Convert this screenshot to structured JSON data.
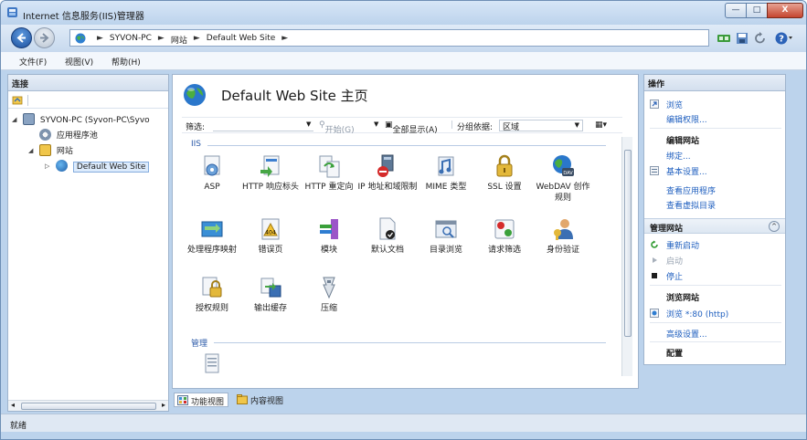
{
  "window": {
    "title": "Internet 信息服务(IIS)管理器",
    "controls": {
      "minimize": "—",
      "maximize": "□",
      "close": "X"
    }
  },
  "address": {
    "crumbs": [
      "SYVON-PC",
      "网站",
      "Default Web Site"
    ],
    "separator": "►"
  },
  "menu": {
    "items": [
      "文件(F)",
      "视图(V)",
      "帮助(H)"
    ]
  },
  "connections": {
    "header": "连接",
    "tree": [
      {
        "label": "SYVON-PC (Syvon-PC\\Syvo",
        "expander": "◢",
        "icon": "server-icon"
      },
      {
        "label": "应用程序池",
        "expander": "",
        "icon": "app-pool-icon"
      },
      {
        "label": "网站",
        "expander": "◢",
        "icon": "sites-folder-icon"
      },
      {
        "label": "Default Web Site",
        "expander": "▷",
        "icon": "website-globe-icon"
      }
    ],
    "scroll_left": "◂",
    "scroll_right": "▸"
  },
  "home": {
    "title": "Default Web Site 主页",
    "filter": {
      "label": "筛选:",
      "go": "开始(G)",
      "show_all": "全部显示(A)",
      "group_by_label": "分组依据:",
      "group_by_value": "区域"
    },
    "sections": [
      {
        "name": "IIS",
        "features": [
          {
            "label": "ASP",
            "icon": "asp-icon"
          },
          {
            "label": "HTTP 响应标头",
            "icon": "http-response-headers-icon"
          },
          {
            "label": "HTTP 重定向",
            "icon": "http-redirect-icon"
          },
          {
            "label": "IP 地址和域限制",
            "icon": "ip-domain-restrictions-icon"
          },
          {
            "label": "MIME 类型",
            "icon": "mime-types-icon"
          },
          {
            "label": "SSL 设置",
            "icon": "ssl-lock-icon"
          },
          {
            "label": "WebDAV 创作规则",
            "icon": "webdav-icon"
          },
          {
            "label": "处理程序映射",
            "icon": "handler-mappings-icon"
          },
          {
            "label": "错误页",
            "icon": "error-pages-icon"
          },
          {
            "label": "模块",
            "icon": "modules-icon"
          },
          {
            "label": "默认文档",
            "icon": "default-document-icon"
          },
          {
            "label": "目录浏览",
            "icon": "directory-browsing-icon"
          },
          {
            "label": "请求筛选",
            "icon": "request-filtering-icon"
          },
          {
            "label": "身份验证",
            "icon": "authentication-icon"
          },
          {
            "label": "授权规则",
            "icon": "authorization-rules-icon"
          },
          {
            "label": "输出缓存",
            "icon": "output-caching-icon"
          },
          {
            "label": "压缩",
            "icon": "compression-icon"
          }
        ]
      },
      {
        "name": "管理",
        "features": [
          {
            "label": "",
            "icon": "configuration-editor-icon"
          }
        ]
      }
    ],
    "view_tabs": [
      {
        "label": "功能视图",
        "active": true
      },
      {
        "label": "内容视图",
        "active": false
      }
    ]
  },
  "actions": {
    "header": "操作",
    "top_links": [
      "浏览",
      "编辑权限..."
    ],
    "edit_site": {
      "title": "编辑网站",
      "links": [
        "绑定...",
        "基本设置...",
        "查看应用程序",
        "查看虚拟目录"
      ]
    },
    "manage_site": {
      "title": "管理网站",
      "collapse": "^",
      "links": [
        {
          "label": "重新启动",
          "disabled": false
        },
        {
          "label": "启动",
          "disabled": true
        },
        {
          "label": "停止",
          "disabled": false
        }
      ]
    },
    "browse_site": {
      "title": "浏览网站",
      "links": [
        "浏览 *:80 (http)",
        "高级设置..."
      ]
    },
    "config": {
      "title": "配置"
    }
  },
  "status": {
    "text": "就绪"
  },
  "colors": {
    "accent_link": "#1f5fbf",
    "window_frame": "#bcd3ec",
    "section_header": "#2b5aa8"
  }
}
